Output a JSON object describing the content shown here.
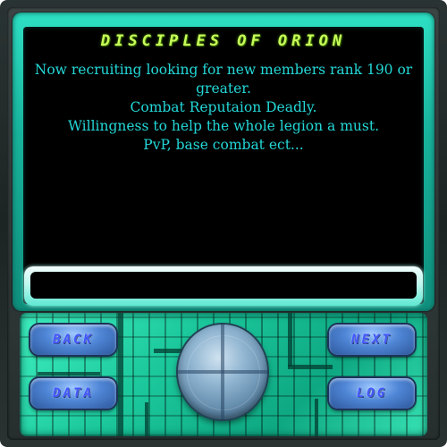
{
  "window": {
    "title": "DISCIPLES OF ORION"
  },
  "message": {
    "lines": [
      "Now recruiting looking for new members rank 190 or",
      "greater.",
      "Combat Reputaion Deadly.",
      "Willingness to help the whole legion a must.",
      "PvP, base combat ect..."
    ]
  },
  "input": {
    "value": "",
    "placeholder": ""
  },
  "controls": {
    "back_label": "BACK",
    "next_label": "NEXT",
    "data_label": "DATA",
    "log_label": "LOG"
  },
  "colors": {
    "title": "#c9ff5a",
    "message_text": "#24d7d7",
    "bezel": "#18b39c",
    "button": "#4f86d6"
  },
  "icons": {
    "center_dial": "dial-icon"
  }
}
